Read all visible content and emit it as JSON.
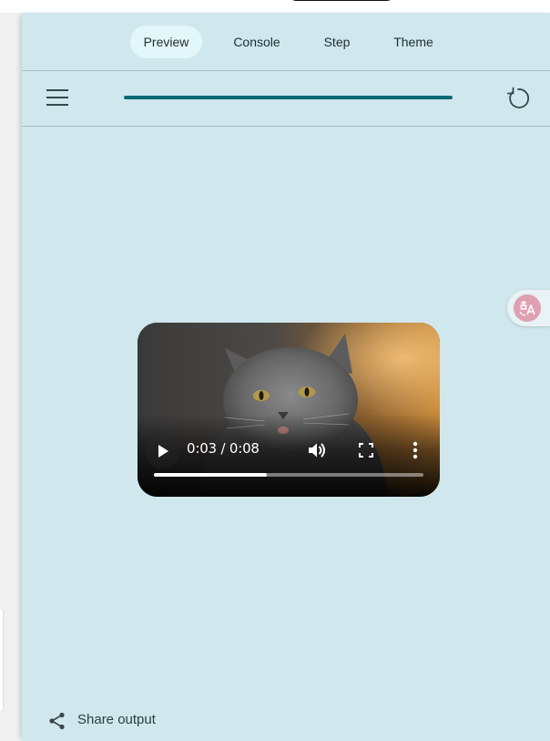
{
  "tabs": [
    {
      "label": "Preview",
      "active": true
    },
    {
      "label": "Console",
      "active": false
    },
    {
      "label": "Step",
      "active": false
    },
    {
      "label": "Theme",
      "active": false
    }
  ],
  "toolbar": {
    "menu_icon": "hamburger-menu-icon",
    "progress_fraction": 1.0,
    "reload_icon": "reload-icon"
  },
  "video": {
    "time": "0:03 / 0:08",
    "played_fraction": 0.42,
    "icons": [
      "play-icon",
      "volume-icon",
      "fullscreen-icon",
      "more-vert-icon"
    ]
  },
  "share": {
    "label": "Share output",
    "icon": "share-icon"
  },
  "floating": {
    "icon": "translate-icon"
  },
  "colors": {
    "panel_bg": "#cfe7ed",
    "accent": "#006874",
    "active_tab_bg": "#e3f6fa"
  }
}
